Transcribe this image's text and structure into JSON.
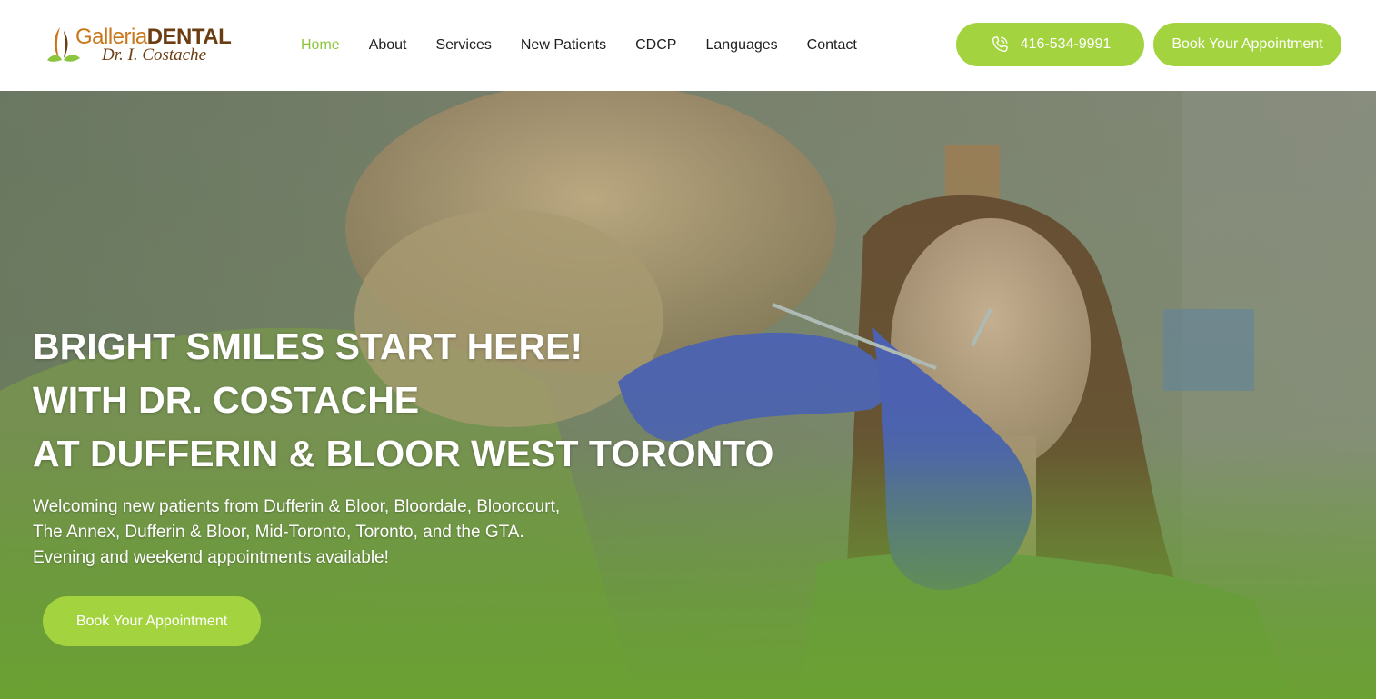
{
  "brand": {
    "name_part1": "Galleria",
    "name_part2": "DENTAL",
    "subtitle": "Dr. I. Costache"
  },
  "nav": {
    "items": [
      {
        "label": "Home",
        "active": true
      },
      {
        "label": "About",
        "active": false
      },
      {
        "label": "Services",
        "active": false
      },
      {
        "label": "New Patients",
        "active": false
      },
      {
        "label": "CDCP",
        "active": false
      },
      {
        "label": "Languages",
        "active": false
      },
      {
        "label": "Contact",
        "active": false
      }
    ]
  },
  "header_actions": {
    "phone_label": "416-534-9991",
    "phone_icon": "phone-icon",
    "book_label": "Book Your Appointment"
  },
  "hero": {
    "title_lines": [
      "BRIGHT SMILES START HERE!",
      "WITH DR. COSTACHE",
      "AT DUFFERIN & BLOOR WEST TORONTO"
    ],
    "text_lines": [
      "Welcoming new patients from Dufferin & Bloor, Bloordale, Bloorcourt,",
      "The Annex, Dufferin & Bloor, Mid-Toronto, Toronto, and the GTA.",
      "Evening and weekend appointments available!"
    ],
    "cta_label": "Book Your Appointment"
  },
  "colors": {
    "accent": "#a3d43f",
    "nav_active": "#8cc63f",
    "brand_orange": "#c8781a",
    "brand_brown": "#6b3d12"
  }
}
